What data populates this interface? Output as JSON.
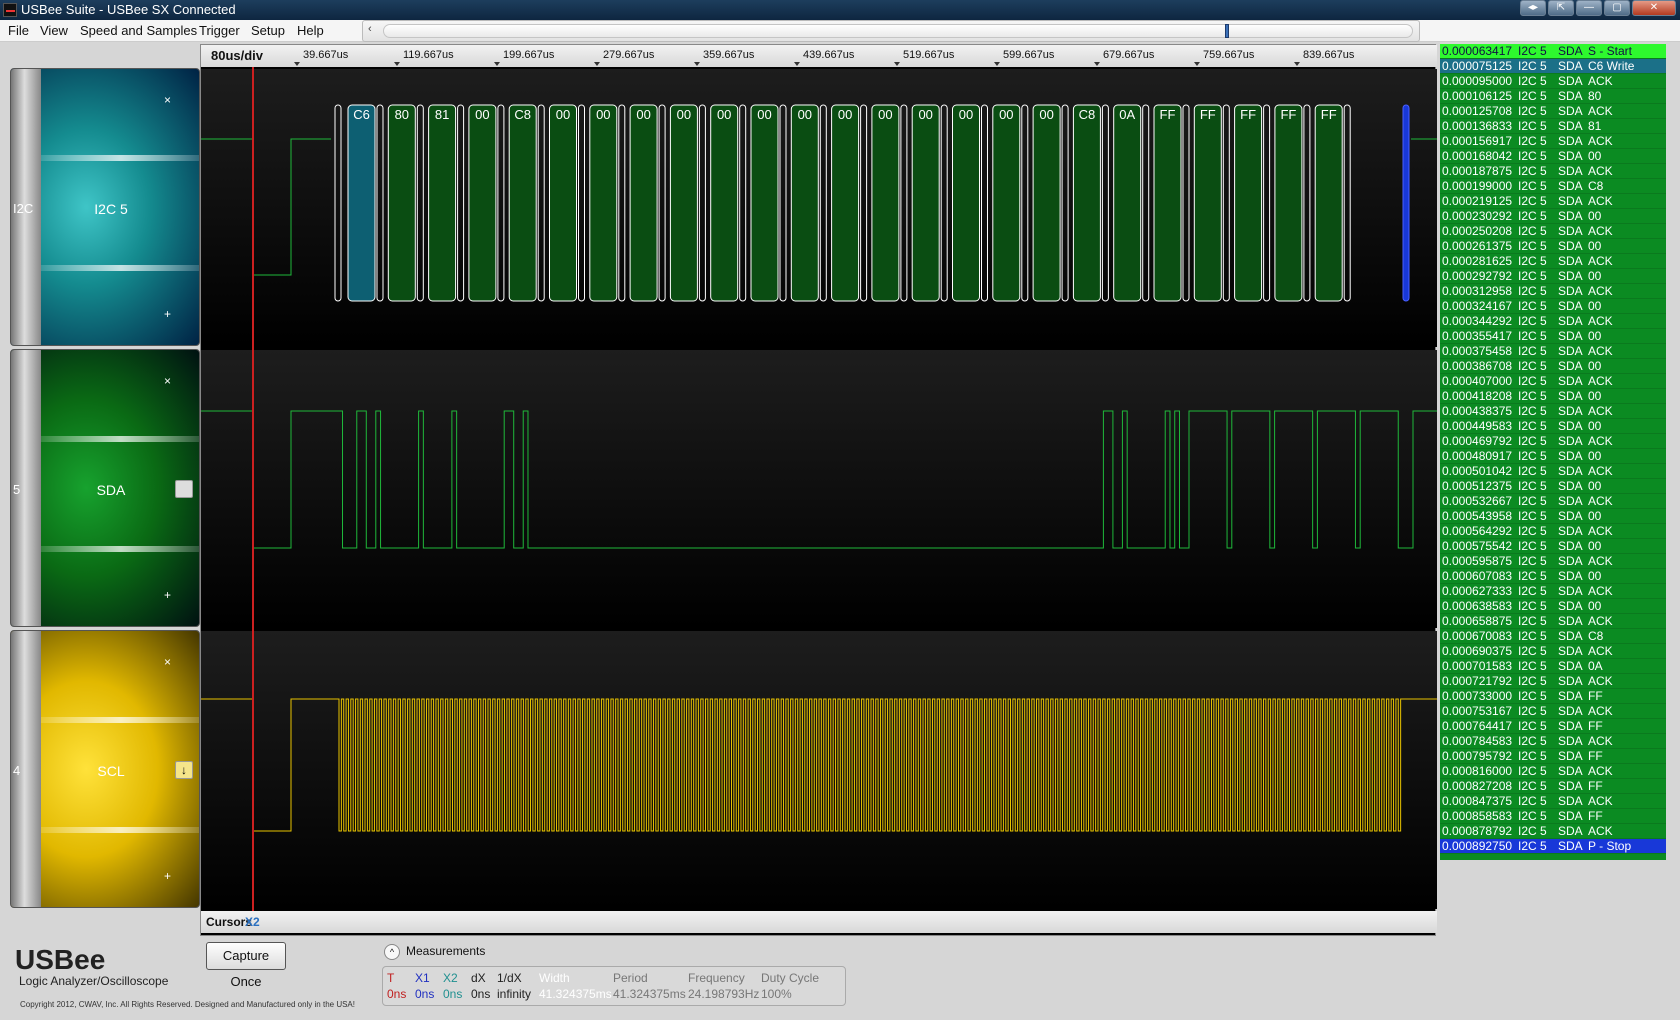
{
  "window": {
    "title": "USBee Suite - USBee SX Connected"
  },
  "menu": [
    "File",
    "View",
    "Speed and Samples",
    "Trigger",
    "Setup",
    "Help"
  ],
  "timebase": {
    "scale": "80us/div",
    "ticks": [
      "39.667us",
      "119.667us",
      "199.667us",
      "279.667us",
      "359.667us",
      "439.667us",
      "519.667us",
      "599.667us",
      "679.667us",
      "759.667us",
      "839.667us"
    ]
  },
  "channels": [
    {
      "number": "I2C",
      "name": "I2C 5",
      "color": "#148b8f"
    },
    {
      "number": "5",
      "name": "SDA",
      "color": "#0a6a14"
    },
    {
      "number": "4",
      "name": "SCL",
      "color": "#e1b800"
    }
  ],
  "channel_controls": {
    "zoom_out": "×",
    "zoom_in": "+",
    "scl_trigger_mark": "↓"
  },
  "i2c_bytes": [
    "C6",
    "80",
    "81",
    "00",
    "C8",
    "00",
    "00",
    "00",
    "00",
    "00",
    "00",
    "00",
    "00",
    "00",
    "00",
    "00",
    "00",
    "00",
    "C8",
    "0A",
    "FF",
    "FF",
    "FF",
    "FF",
    "FF"
  ],
  "decoder_rows": [
    {
      "time": "0.000063417",
      "bus": "I2C 5",
      "signal": "SDA",
      "value": "S - Start"
    },
    {
      "time": "0.000075125",
      "bus": "I2C 5",
      "signal": "SDA",
      "value": "C6 Write"
    },
    {
      "time": "0.000095000",
      "bus": "I2C 5",
      "signal": "SDA",
      "value": "ACK"
    },
    {
      "time": "0.000106125",
      "bus": "I2C 5",
      "signal": "SDA",
      "value": "80"
    },
    {
      "time": "0.000125708",
      "bus": "I2C 5",
      "signal": "SDA",
      "value": "ACK"
    },
    {
      "time": "0.000136833",
      "bus": "I2C 5",
      "signal": "SDA",
      "value": "81"
    },
    {
      "time": "0.000156917",
      "bus": "I2C 5",
      "signal": "SDA",
      "value": "ACK"
    },
    {
      "time": "0.000168042",
      "bus": "I2C 5",
      "signal": "SDA",
      "value": "00"
    },
    {
      "time": "0.000187875",
      "bus": "I2C 5",
      "signal": "SDA",
      "value": "ACK"
    },
    {
      "time": "0.000199000",
      "bus": "I2C 5",
      "signal": "SDA",
      "value": "C8"
    },
    {
      "time": "0.000219125",
      "bus": "I2C 5",
      "signal": "SDA",
      "value": "ACK"
    },
    {
      "time": "0.000230292",
      "bus": "I2C 5",
      "signal": "SDA",
      "value": "00"
    },
    {
      "time": "0.000250208",
      "bus": "I2C 5",
      "signal": "SDA",
      "value": "ACK"
    },
    {
      "time": "0.000261375",
      "bus": "I2C 5",
      "signal": "SDA",
      "value": "00"
    },
    {
      "time": "0.000281625",
      "bus": "I2C 5",
      "signal": "SDA",
      "value": "ACK"
    },
    {
      "time": "0.000292792",
      "bus": "I2C 5",
      "signal": "SDA",
      "value": "00"
    },
    {
      "time": "0.000312958",
      "bus": "I2C 5",
      "signal": "SDA",
      "value": "ACK"
    },
    {
      "time": "0.000324167",
      "bus": "I2C 5",
      "signal": "SDA",
      "value": "00"
    },
    {
      "time": "0.000344292",
      "bus": "I2C 5",
      "signal": "SDA",
      "value": "ACK"
    },
    {
      "time": "0.000355417",
      "bus": "I2C 5",
      "signal": "SDA",
      "value": "00"
    },
    {
      "time": "0.000375458",
      "bus": "I2C 5",
      "signal": "SDA",
      "value": "ACK"
    },
    {
      "time": "0.000386708",
      "bus": "I2C 5",
      "signal": "SDA",
      "value": "00"
    },
    {
      "time": "0.000407000",
      "bus": "I2C 5",
      "signal": "SDA",
      "value": "ACK"
    },
    {
      "time": "0.000418208",
      "bus": "I2C 5",
      "signal": "SDA",
      "value": "00"
    },
    {
      "time": "0.000438375",
      "bus": "I2C 5",
      "signal": "SDA",
      "value": "ACK"
    },
    {
      "time": "0.000449583",
      "bus": "I2C 5",
      "signal": "SDA",
      "value": "00"
    },
    {
      "time": "0.000469792",
      "bus": "I2C 5",
      "signal": "SDA",
      "value": "ACK"
    },
    {
      "time": "0.000480917",
      "bus": "I2C 5",
      "signal": "SDA",
      "value": "00"
    },
    {
      "time": "0.000501042",
      "bus": "I2C 5",
      "signal": "SDA",
      "value": "ACK"
    },
    {
      "time": "0.000512375",
      "bus": "I2C 5",
      "signal": "SDA",
      "value": "00"
    },
    {
      "time": "0.000532667",
      "bus": "I2C 5",
      "signal": "SDA",
      "value": "ACK"
    },
    {
      "time": "0.000543958",
      "bus": "I2C 5",
      "signal": "SDA",
      "value": "00"
    },
    {
      "time": "0.000564292",
      "bus": "I2C 5",
      "signal": "SDA",
      "value": "ACK"
    },
    {
      "time": "0.000575542",
      "bus": "I2C 5",
      "signal": "SDA",
      "value": "00"
    },
    {
      "time": "0.000595875",
      "bus": "I2C 5",
      "signal": "SDA",
      "value": "ACK"
    },
    {
      "time": "0.000607083",
      "bus": "I2C 5",
      "signal": "SDA",
      "value": "00"
    },
    {
      "time": "0.000627333",
      "bus": "I2C 5",
      "signal": "SDA",
      "value": "ACK"
    },
    {
      "time": "0.000638583",
      "bus": "I2C 5",
      "signal": "SDA",
      "value": "00"
    },
    {
      "time": "0.000658875",
      "bus": "I2C 5",
      "signal": "SDA",
      "value": "ACK"
    },
    {
      "time": "0.000670083",
      "bus": "I2C 5",
      "signal": "SDA",
      "value": "C8"
    },
    {
      "time": "0.000690375",
      "bus": "I2C 5",
      "signal": "SDA",
      "value": "ACK"
    },
    {
      "time": "0.000701583",
      "bus": "I2C 5",
      "signal": "SDA",
      "value": "0A"
    },
    {
      "time": "0.000721792",
      "bus": "I2C 5",
      "signal": "SDA",
      "value": "ACK"
    },
    {
      "time": "0.000733000",
      "bus": "I2C 5",
      "signal": "SDA",
      "value": "FF"
    },
    {
      "time": "0.000753167",
      "bus": "I2C 5",
      "signal": "SDA",
      "value": "ACK"
    },
    {
      "time": "0.000764417",
      "bus": "I2C 5",
      "signal": "SDA",
      "value": "FF"
    },
    {
      "time": "0.000784583",
      "bus": "I2C 5",
      "signal": "SDA",
      "value": "ACK"
    },
    {
      "time": "0.000795792",
      "bus": "I2C 5",
      "signal": "SDA",
      "value": "FF"
    },
    {
      "time": "0.000816000",
      "bus": "I2C 5",
      "signal": "SDA",
      "value": "ACK"
    },
    {
      "time": "0.000827208",
      "bus": "I2C 5",
      "signal": "SDA",
      "value": "FF"
    },
    {
      "time": "0.000847375",
      "bus": "I2C 5",
      "signal": "SDA",
      "value": "ACK"
    },
    {
      "time": "0.000858583",
      "bus": "I2C 5",
      "signal": "SDA",
      "value": "FF"
    },
    {
      "time": "0.000878792",
      "bus": "I2C 5",
      "signal": "SDA",
      "value": "ACK"
    },
    {
      "time": "0.000892750",
      "bus": "I2C 5",
      "signal": "SDA",
      "value": "P - Stop"
    }
  ],
  "cursors": {
    "label": "Cursors",
    "x2": "X2"
  },
  "capture_button": "Capture Once",
  "branding": {
    "logo": "USBee",
    "subtitle": "Logic Analyzer/Oscilloscope",
    "copyright": "Copyright 2012, CWAV, Inc. All Rights Reserved. Designed and Manufactured only in the USA!"
  },
  "measurements": {
    "title": "Measurements",
    "columns": [
      {
        "label": "T",
        "value": "0ns",
        "color": "#c02020"
      },
      {
        "label": "X1",
        "value": "0ns",
        "color": "#2030c0"
      },
      {
        "label": "X2",
        "value": "0ns",
        "color": "#209090"
      },
      {
        "label": "dX",
        "value": "0ns",
        "color": "#222222"
      },
      {
        "label": "1/dX",
        "value": "infinity",
        "color": "#222222"
      },
      {
        "label": "Width",
        "value": "41.324375ms",
        "color": "#ffffff"
      },
      {
        "label": "Period",
        "value": "41.324375ms",
        "color": "#777777"
      },
      {
        "label": "Frequency",
        "value": "24.198793Hz",
        "color": "#777777"
      },
      {
        "label": "Duty Cycle",
        "value": "100%",
        "color": "#777777"
      }
    ]
  },
  "colors": {
    "sda_wave": "#1fb83a",
    "scl_wave": "#e8c300",
    "i2c_box_border": "#ffffff",
    "cursor_red": "#cc2020",
    "decoder_bg": "#0b8b22",
    "start_row": "#2ef92e",
    "write_row": "#1b7088",
    "stop_row": "#1838d8"
  }
}
